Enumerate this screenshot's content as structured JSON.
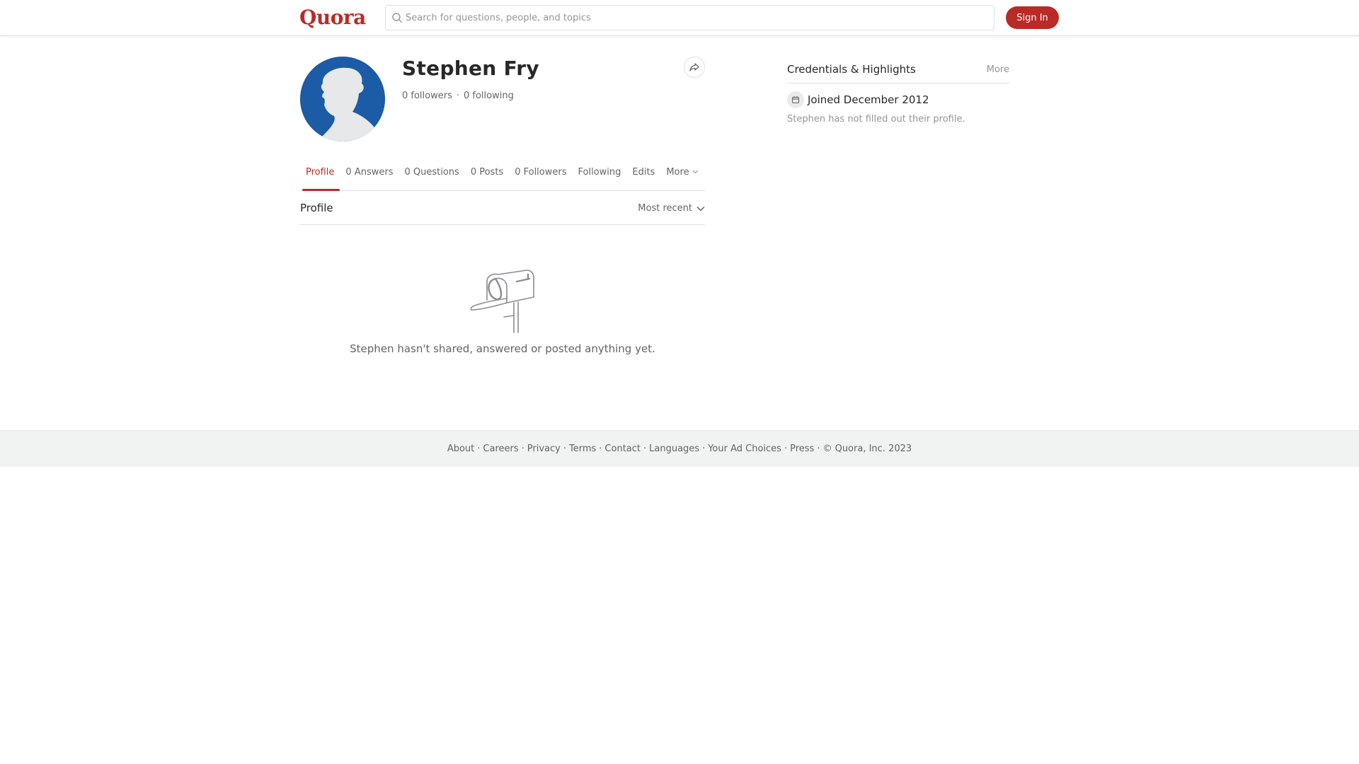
{
  "header": {
    "logo": "Quora",
    "search_placeholder": "Search for questions, people, and topics",
    "signin_label": "Sign In"
  },
  "profile": {
    "name": "Stephen Fry",
    "followers": "0 followers",
    "following": "0 following",
    "separator": "·"
  },
  "tabs": [
    {
      "label": "Profile",
      "active": true
    },
    {
      "label": "0 Answers"
    },
    {
      "label": "0 Questions"
    },
    {
      "label": "0 Posts"
    },
    {
      "label": "0 Followers"
    },
    {
      "label": "Following"
    },
    {
      "label": "Edits"
    },
    {
      "label": "More"
    }
  ],
  "feed": {
    "title": "Profile",
    "sort": "Most recent",
    "empty_message": "Stephen hasn't shared, answered or posted anything yet."
  },
  "credentials": {
    "title": "Credentials & Highlights",
    "more": "More",
    "joined": "Joined December 2012",
    "not_filled": "Stephen has not filled out their profile."
  },
  "footer": {
    "links": [
      "About",
      "Careers",
      "Privacy",
      "Terms",
      "Contact",
      "Languages",
      "Your Ad Choices",
      "Press"
    ],
    "separator": "·",
    "copyright": "© Quora, Inc. 2023"
  },
  "colors": {
    "brand": "#b92b27",
    "avatar_bg": "#1c5ba6",
    "text_primary": "#282829",
    "text_secondary": "#636466",
    "text_muted": "#939598",
    "footer_bg": "#f1f2f2"
  },
  "icons": {
    "search": "search-icon",
    "share": "share-icon",
    "chevron": "chevron-down-icon",
    "calendar": "calendar-icon",
    "mailbox": "mailbox-illustration"
  }
}
